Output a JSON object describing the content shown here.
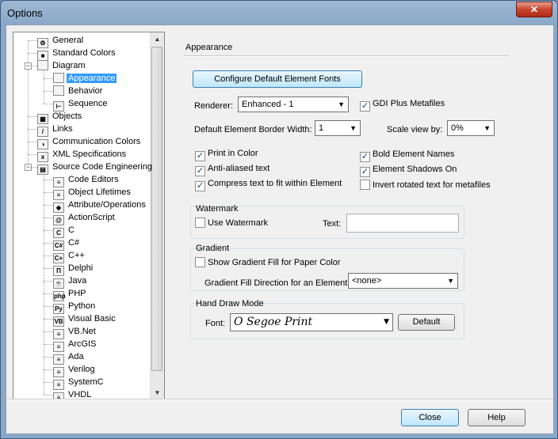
{
  "window": {
    "title": "Options",
    "close_glyph": "✕"
  },
  "tree": {
    "items": [
      {
        "label": "General",
        "icon": "general-icon",
        "glyph": "⚙"
      },
      {
        "label": "Standard Colors",
        "icon": "colors-icon",
        "glyph": "■"
      },
      {
        "label": "Diagram",
        "icon": "diagram-icon",
        "glyph": ""
      },
      {
        "label": "Appearance",
        "icon": "appearance-icon",
        "glyph": ""
      },
      {
        "label": "Behavior",
        "icon": "behavior-icon",
        "glyph": ""
      },
      {
        "label": "Sequence",
        "icon": "sequence-icon",
        "glyph": "⊢"
      },
      {
        "label": "Objects",
        "icon": "objects-icon",
        "glyph": "▦"
      },
      {
        "label": "Links",
        "icon": "links-icon",
        "glyph": "/"
      },
      {
        "label": "Communication Colors",
        "icon": "communication-icon",
        "glyph": "◑"
      },
      {
        "label": "XML Specifications",
        "icon": "xml-icon",
        "glyph": "x"
      },
      {
        "label": "Source Code Engineering",
        "icon": "source-code-icon",
        "glyph": "▤"
      },
      {
        "label": "Code Editors",
        "icon": "code-editors-icon",
        "glyph": "≡"
      },
      {
        "label": "Object Lifetimes",
        "icon": "object-lifetimes-icon",
        "glyph": "≡"
      },
      {
        "label": "Attribute/Operations",
        "icon": "attribute-operations-icon",
        "glyph": "◆"
      },
      {
        "label": "ActionScript",
        "icon": "actionscript-icon",
        "glyph": "@"
      },
      {
        "label": "C",
        "icon": "c-language-icon",
        "glyph": "C"
      },
      {
        "label": "C#",
        "icon": "csharp-icon",
        "glyph": "C#"
      },
      {
        "label": "C++",
        "icon": "cpp-icon",
        "glyph": "C+"
      },
      {
        "label": "Delphi",
        "icon": "delphi-icon",
        "glyph": "Π"
      },
      {
        "label": "Java",
        "icon": "java-icon",
        "glyph": "☕"
      },
      {
        "label": "PHP",
        "icon": "php-icon",
        "glyph": "php"
      },
      {
        "label": "Python",
        "icon": "python-icon",
        "glyph": "Py"
      },
      {
        "label": "Visual Basic",
        "icon": "visual-basic-icon",
        "glyph": "VB"
      },
      {
        "label": "VB.Net",
        "icon": "vbnet-icon",
        "glyph": "≡"
      },
      {
        "label": "ArcGIS",
        "icon": "arcgis-icon",
        "glyph": "≡"
      },
      {
        "label": "Ada",
        "icon": "ada-icon",
        "glyph": "≡"
      },
      {
        "label": "Verilog",
        "icon": "verilog-icon",
        "glyph": "≡"
      },
      {
        "label": "SystemC",
        "icon": "systemc-icon",
        "glyph": "≡"
      },
      {
        "label": "VHDL",
        "icon": "vhdl-icon",
        "glyph": "≡"
      }
    ],
    "selected": "Appearance",
    "expanders": {
      "diagram": "−",
      "source": "−"
    },
    "scroll_up": "▲",
    "scroll_down": "▼"
  },
  "panel": {
    "title": "Appearance",
    "configure_fonts_label": "Configure Default Element Fonts",
    "renderer_label": "Renderer:",
    "renderer_value": "Enhanced - 1",
    "gdi_label": "GDI Plus Metafiles",
    "gdi_checked": true,
    "border_width_label": "Default Element Border Width:",
    "border_width_value": "1",
    "scale_label": "Scale view by:",
    "scale_value": "0%",
    "dropdown_arrow": "▼",
    "check_glyph": "✓",
    "checks_left": [
      {
        "label": "Print in Color",
        "checked": true
      },
      {
        "label": "Anti-aliased text",
        "checked": true
      },
      {
        "label": "Compress text to fit within Element",
        "checked": true
      }
    ],
    "checks_right": [
      {
        "label": "Bold Element Names",
        "checked": true
      },
      {
        "label": "Element Shadows On",
        "checked": true
      },
      {
        "label": "Invert rotated text for metafiles",
        "checked": false
      }
    ],
    "watermark": {
      "title": "Watermark",
      "use_label": "Use Watermark",
      "use_checked": false,
      "text_label": "Text:",
      "text_value": ""
    },
    "gradient": {
      "title": "Gradient",
      "show_label": "Show Gradient Fill for Paper Color",
      "show_checked": false,
      "direction_label": "Gradient Fill Direction for an Element:",
      "direction_value": "<none>"
    },
    "hand_draw": {
      "title": "Hand Draw Mode",
      "font_label": "Font:",
      "font_value": "Segoe Print",
      "font_prefix": "O",
      "default_label": "Default"
    }
  },
  "footer": {
    "close_label": "Close",
    "help_label": "Help"
  }
}
